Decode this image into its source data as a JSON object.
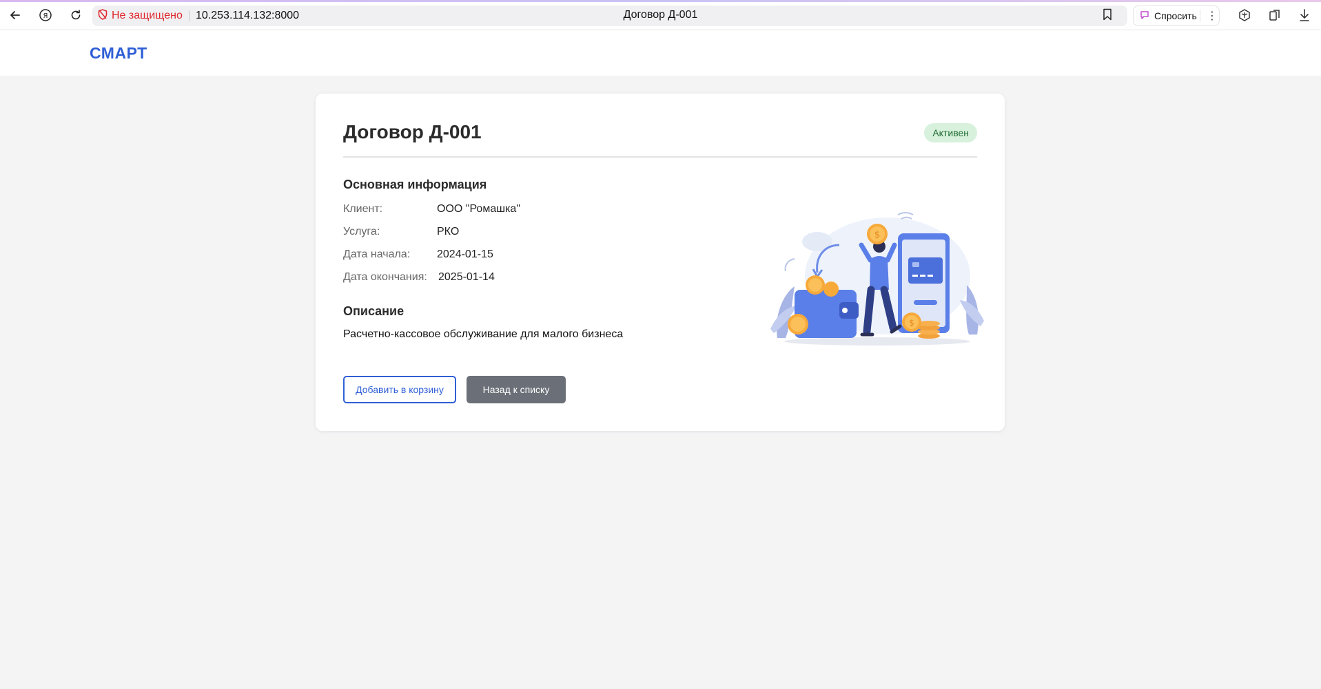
{
  "browser": {
    "security_label": "Не защищено",
    "url": "10.253.114.132:8000",
    "tab_title": "Договор Д-001",
    "ask_label": "Спросить",
    "menu_dots": "⋮",
    "icons": [
      "back-arrow-icon",
      "yandex-icon",
      "reload-icon",
      "shield-warning-icon",
      "bookmark-icon",
      "ask-icon",
      "more-icon",
      "extension-icon",
      "collections-icon",
      "download-icon"
    ]
  },
  "site": {
    "logo": "СМАРТ"
  },
  "contract": {
    "title": "Договор Д-001",
    "status": "Активен",
    "main_info_heading": "Основная информация",
    "fields": [
      {
        "label": "Клиент:",
        "value": "ООО \"Ромашка\""
      },
      {
        "label": "Услуга:",
        "value": "РКО"
      },
      {
        "label": "Дата начала:",
        "value": "2024-01-15"
      },
      {
        "label": "Дата окончания:",
        "value": "2025-01-14"
      }
    ],
    "description_heading": "Описание",
    "description": "Расчетно-кассовое обслуживание для малого бизнеса"
  },
  "actions": {
    "add_to_cart": "Добавить в корзину",
    "back_to_list": "Назад к списку"
  },
  "colors": {
    "brand": "#2f5fd6",
    "badge_bg": "#d7f1dc",
    "badge_text": "#1f6b33",
    "secondary_button": "#6b7078",
    "page_bg": "#f4f4f5"
  }
}
